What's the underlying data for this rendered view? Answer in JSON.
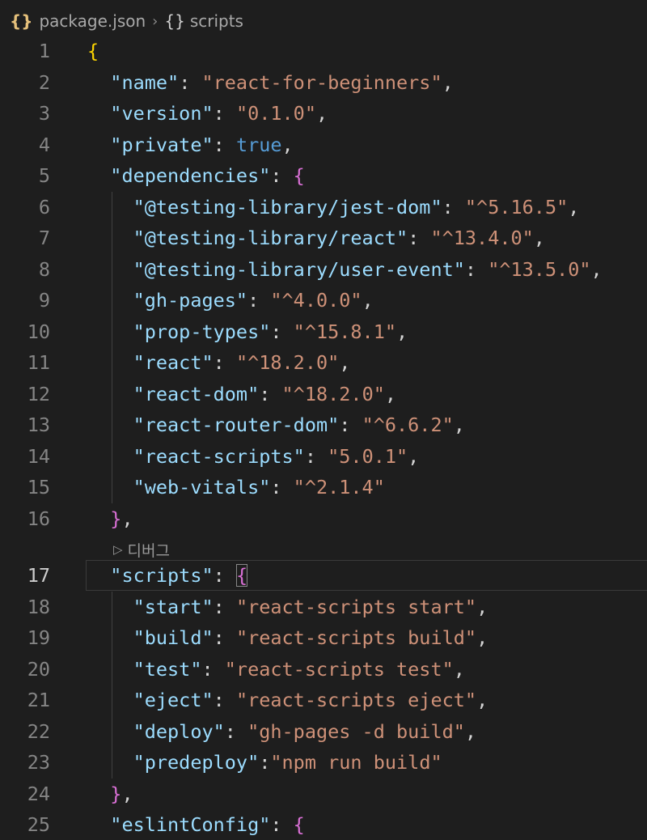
{
  "breadcrumb": {
    "file_icon": "{}",
    "file": "package.json",
    "separator": "›",
    "symbol_icon": "{}",
    "symbol": "scripts"
  },
  "codelens": {
    "label": "디버그"
  },
  "lines": [
    {
      "n": "1",
      "tokens": [
        [
          "b1",
          "{"
        ]
      ]
    },
    {
      "n": "2",
      "tokens": [
        [
          "p",
          "  "
        ],
        [
          "key",
          "\"name\""
        ],
        [
          "p",
          ": "
        ],
        [
          "str",
          "\"react-for-beginners\""
        ],
        [
          "p",
          ","
        ]
      ]
    },
    {
      "n": "3",
      "tokens": [
        [
          "p",
          "  "
        ],
        [
          "key",
          "\"version\""
        ],
        [
          "p",
          ": "
        ],
        [
          "str",
          "\"0.1.0\""
        ],
        [
          "p",
          ","
        ]
      ]
    },
    {
      "n": "4",
      "tokens": [
        [
          "p",
          "  "
        ],
        [
          "key",
          "\"private\""
        ],
        [
          "p",
          ": "
        ],
        [
          "kw",
          "true"
        ],
        [
          "p",
          ","
        ]
      ]
    },
    {
      "n": "5",
      "tokens": [
        [
          "p",
          "  "
        ],
        [
          "key",
          "\"dependencies\""
        ],
        [
          "p",
          ": "
        ],
        [
          "b2",
          "{"
        ]
      ]
    },
    {
      "n": "6",
      "tokens": [
        [
          "p",
          "    "
        ],
        [
          "key",
          "\"@testing-library/jest-dom\""
        ],
        [
          "p",
          ": "
        ],
        [
          "str",
          "\"^5.16.5\""
        ],
        [
          "p",
          ","
        ]
      ]
    },
    {
      "n": "7",
      "tokens": [
        [
          "p",
          "    "
        ],
        [
          "key",
          "\"@testing-library/react\""
        ],
        [
          "p",
          ": "
        ],
        [
          "str",
          "\"^13.4.0\""
        ],
        [
          "p",
          ","
        ]
      ]
    },
    {
      "n": "8",
      "tokens": [
        [
          "p",
          "    "
        ],
        [
          "key",
          "\"@testing-library/user-event\""
        ],
        [
          "p",
          ": "
        ],
        [
          "str",
          "\"^13.5.0\""
        ],
        [
          "p",
          ","
        ]
      ]
    },
    {
      "n": "9",
      "tokens": [
        [
          "p",
          "    "
        ],
        [
          "key",
          "\"gh-pages\""
        ],
        [
          "p",
          ": "
        ],
        [
          "str",
          "\"^4.0.0\""
        ],
        [
          "p",
          ","
        ]
      ]
    },
    {
      "n": "10",
      "tokens": [
        [
          "p",
          "    "
        ],
        [
          "key",
          "\"prop-types\""
        ],
        [
          "p",
          ": "
        ],
        [
          "str",
          "\"^15.8.1\""
        ],
        [
          "p",
          ","
        ]
      ]
    },
    {
      "n": "11",
      "tokens": [
        [
          "p",
          "    "
        ],
        [
          "key",
          "\"react\""
        ],
        [
          "p",
          ": "
        ],
        [
          "str",
          "\"^18.2.0\""
        ],
        [
          "p",
          ","
        ]
      ]
    },
    {
      "n": "12",
      "tokens": [
        [
          "p",
          "    "
        ],
        [
          "key",
          "\"react-dom\""
        ],
        [
          "p",
          ": "
        ],
        [
          "str",
          "\"^18.2.0\""
        ],
        [
          "p",
          ","
        ]
      ]
    },
    {
      "n": "13",
      "tokens": [
        [
          "p",
          "    "
        ],
        [
          "key",
          "\"react-router-dom\""
        ],
        [
          "p",
          ": "
        ],
        [
          "str",
          "\"^6.6.2\""
        ],
        [
          "p",
          ","
        ]
      ]
    },
    {
      "n": "14",
      "tokens": [
        [
          "p",
          "    "
        ],
        [
          "key",
          "\"react-scripts\""
        ],
        [
          "p",
          ": "
        ],
        [
          "str",
          "\"5.0.1\""
        ],
        [
          "p",
          ","
        ]
      ]
    },
    {
      "n": "15",
      "tokens": [
        [
          "p",
          "    "
        ],
        [
          "key",
          "\"web-vitals\""
        ],
        [
          "p",
          ": "
        ],
        [
          "str",
          "\"^2.1.4\""
        ]
      ]
    },
    {
      "n": "16",
      "tokens": [
        [
          "p",
          "  "
        ],
        [
          "b2",
          "}"
        ],
        [
          "p",
          ","
        ]
      ]
    },
    {
      "n": "17",
      "tokens": [
        [
          "p",
          "  "
        ],
        [
          "key",
          "\"scripts\""
        ],
        [
          "p",
          ": "
        ],
        [
          "b2",
          "{"
        ]
      ],
      "active": true
    },
    {
      "n": "18",
      "tokens": [
        [
          "p",
          "    "
        ],
        [
          "key",
          "\"start\""
        ],
        [
          "p",
          ": "
        ],
        [
          "str",
          "\"react-scripts start\""
        ],
        [
          "p",
          ","
        ]
      ]
    },
    {
      "n": "19",
      "tokens": [
        [
          "p",
          "    "
        ],
        [
          "key",
          "\"build\""
        ],
        [
          "p",
          ": "
        ],
        [
          "str",
          "\"react-scripts build\""
        ],
        [
          "p",
          ","
        ]
      ]
    },
    {
      "n": "20",
      "tokens": [
        [
          "p",
          "    "
        ],
        [
          "key",
          "\"test\""
        ],
        [
          "p",
          ": "
        ],
        [
          "str",
          "\"react-scripts test\""
        ],
        [
          "p",
          ","
        ]
      ]
    },
    {
      "n": "21",
      "tokens": [
        [
          "p",
          "    "
        ],
        [
          "key",
          "\"eject\""
        ],
        [
          "p",
          ": "
        ],
        [
          "str",
          "\"react-scripts eject\""
        ],
        [
          "p",
          ","
        ]
      ]
    },
    {
      "n": "22",
      "tokens": [
        [
          "p",
          "    "
        ],
        [
          "key",
          "\"deploy\""
        ],
        [
          "p",
          ": "
        ],
        [
          "str",
          "\"gh-pages -d build\""
        ],
        [
          "p",
          ","
        ]
      ]
    },
    {
      "n": "23",
      "tokens": [
        [
          "p",
          "    "
        ],
        [
          "key",
          "\"predeploy\""
        ],
        [
          "p",
          ":"
        ],
        [
          "str",
          "\"npm run build\""
        ]
      ]
    },
    {
      "n": "24",
      "tokens": [
        [
          "p",
          "  "
        ],
        [
          "b2",
          "}"
        ],
        [
          "p",
          ","
        ]
      ]
    },
    {
      "n": "25",
      "tokens": [
        [
          "p",
          "  "
        ],
        [
          "key",
          "\"eslintConfig\""
        ],
        [
          "p",
          ": "
        ],
        [
          "b2",
          "{"
        ]
      ]
    }
  ],
  "colors": {
    "background": "#1e1e1e",
    "key": "#9cdcfe",
    "string": "#ce9178",
    "keyword": "#569cd6",
    "bracket_level1": "#ffd700",
    "bracket_level2": "#da70d6"
  }
}
